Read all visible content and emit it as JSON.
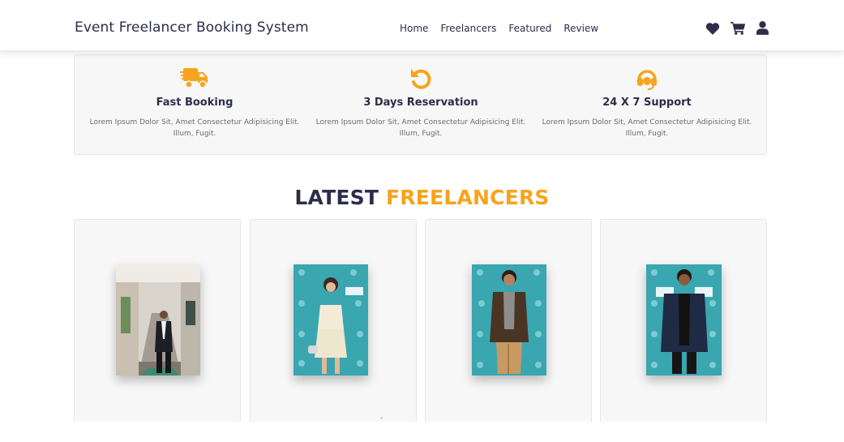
{
  "header": {
    "brand": "Event Freelancer Booking System",
    "nav": [
      "Home",
      "Freelancers",
      "Featured",
      "Review"
    ],
    "icons": [
      "heart-icon",
      "cart-icon",
      "user-icon"
    ]
  },
  "features": [
    {
      "icon": "truck-icon",
      "title": "Fast Booking",
      "desc": "Lorem Ipsum Dolor Sit, Amet Consectetur Adipisicing Elit. Illum, Fugit."
    },
    {
      "icon": "undo-icon",
      "title": "3 Days Reservation",
      "desc": "Lorem Ipsum Dolor Sit, Amet Consectetur Adipisicing Elit. Illum, Fugit."
    },
    {
      "icon": "headset-icon",
      "title": "24 X 7 Support",
      "desc": "Lorem Ipsum Dolor Sit, Amet Consectetur Adipisicing Elit. Illum, Fugit."
    }
  ],
  "section": {
    "title_dark": "LATEST",
    "title_accent": "FREELANCERS"
  },
  "colors": {
    "accent": "#f7a31c",
    "dark": "#2c2e4a",
    "card_bg": "#f7f7f7",
    "backdrop_teal": "#3aa6b0"
  },
  "cards": [
    {
      "photo": "freelancer-photo-corridor"
    },
    {
      "photo": "freelancer-photo-teal-backdrop"
    },
    {
      "photo": "freelancer-photo-teal-backdrop"
    },
    {
      "photo": "freelancer-photo-teal-backdrop"
    }
  ]
}
